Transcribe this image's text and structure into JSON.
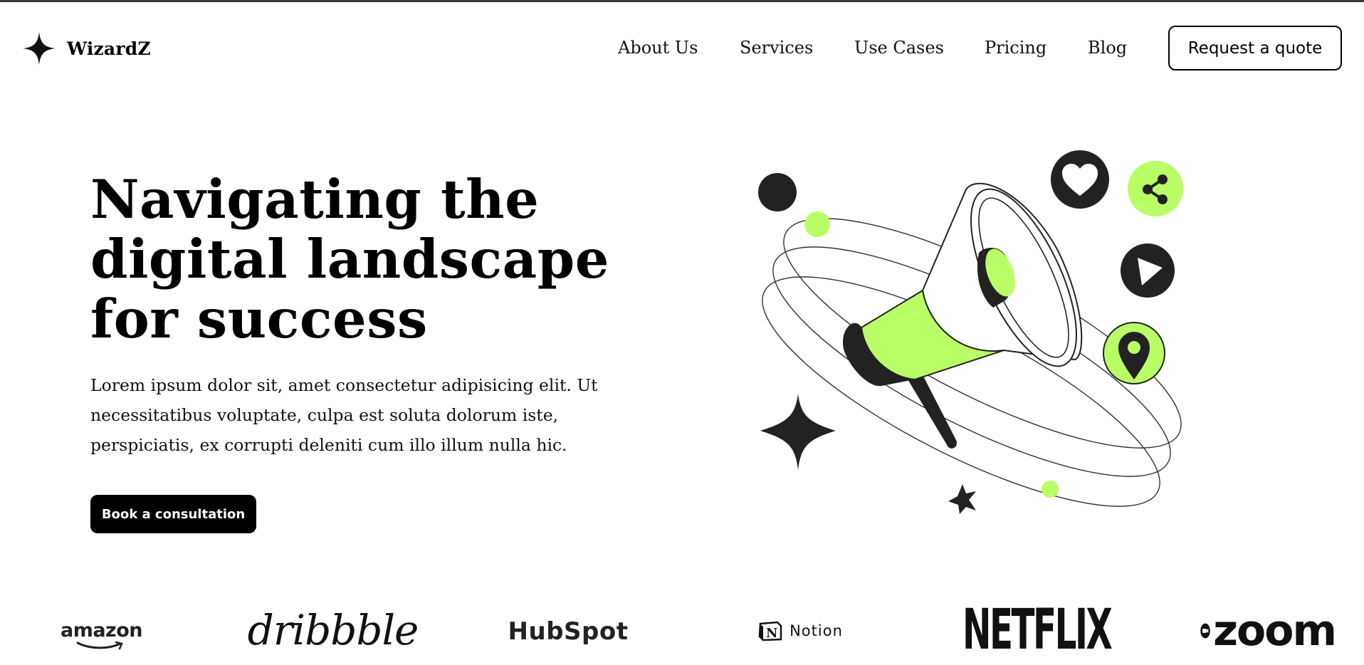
{
  "header": {
    "logo_text": "WizardZ",
    "nav": [
      "About Us",
      "Services",
      "Use Cases",
      "Pricing",
      "Blog"
    ],
    "cta_label": "Request a quote"
  },
  "hero": {
    "title_lines": [
      "Navigating the",
      "digital landscape",
      "for success"
    ],
    "body_lines": [
      "Lorem ipsum dolor sit, amet consectetur adipisicing elit. Ut",
      "necessitatibus voluptate, culpa est soluta dolorum iste,",
      "perspiciatis, ex corrupti deleniti cum illo illum nulla hic."
    ],
    "button_label": "Book a consultation"
  },
  "illustration": {
    "icons": [
      "megaphone-icon",
      "heart-icon",
      "share-icon",
      "play-icon",
      "location-pin-icon",
      "sparkle-star-icon"
    ]
  },
  "brands": {
    "amazon": "amazon",
    "dribbble": "dribbble",
    "hubspot": "HubSpot",
    "notion": "Notion",
    "netflix": "NETFLIX",
    "zoom": "zoom"
  },
  "colors": {
    "accent": "#B9FF66",
    "dark": "#191A23",
    "text": "#000000",
    "background": "#FFFFFF"
  }
}
